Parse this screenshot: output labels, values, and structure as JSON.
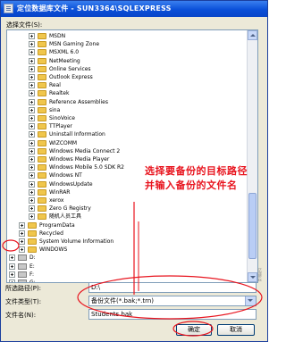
{
  "window": {
    "title": "定位数据库文件 - SUN3364\\SQLEXPRESS"
  },
  "tree": {
    "label": "选择文件(S):",
    "folders": [
      "MSDN",
      "MSN Gaming Zone",
      "MSXML 6.0",
      "NetMeeting",
      "Online Services",
      "Outlook Express",
      "Real",
      "Realtek",
      "Reference Assemblies",
      "sina",
      "SinoVoice",
      "TTPlayer",
      "Uninstall Information",
      "WIZCOMM",
      "Windows Media Connect 2",
      "Windows Media Player",
      "Windows Mobile 5.0 SDK R2",
      "Windows NT",
      "WindowsUpdate",
      "WinRAR",
      "xerox",
      "Zero G Registry",
      "随机人员工具"
    ],
    "root_folders": [
      "ProgramData",
      "Recycled",
      "System Volume Information",
      "WINDOWS"
    ],
    "drives": [
      "D:",
      "E:",
      "F:",
      "G:"
    ]
  },
  "form": {
    "path_label": "所选路径(P):",
    "path_value": "D:\\",
    "type_label": "文件类型(T):",
    "type_value": "备份文件(*.bak;*.trn)",
    "name_label": "文件名(N):",
    "name_value": "Students.bak"
  },
  "buttons": {
    "ok": "确定",
    "cancel": "取消"
  },
  "annotation": {
    "text": "选择要备份的目标路径并输入备份的文件名"
  },
  "watermark": "亿速云"
}
